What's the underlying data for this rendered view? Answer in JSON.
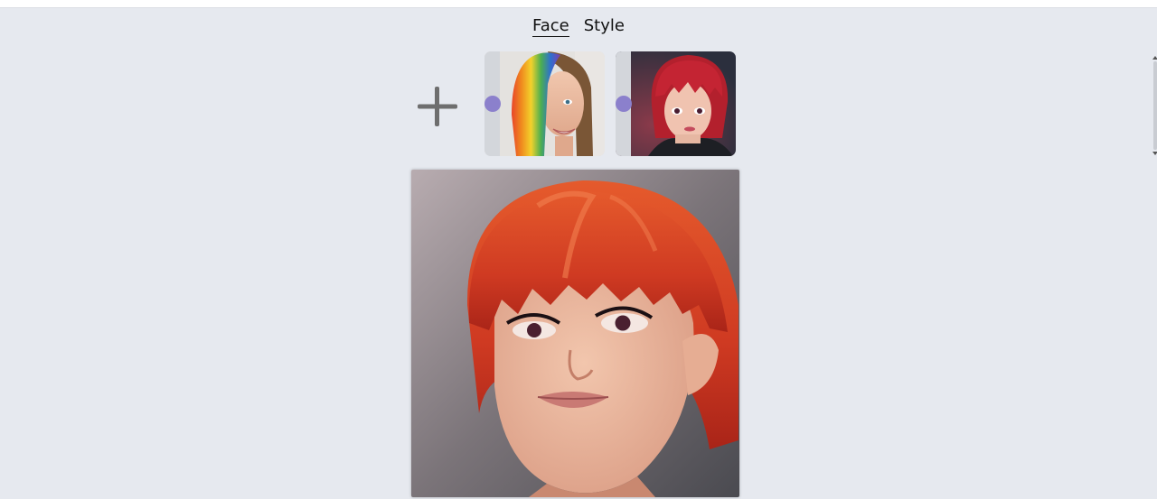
{
  "tabs": [
    {
      "label": "Face",
      "active": true
    },
    {
      "label": "Style",
      "active": false
    }
  ],
  "add_button": {
    "icon": "plus-icon"
  },
  "thumbnails": [
    {
      "name": "rainbow-hair-woman",
      "selected": true
    },
    {
      "name": "red-hair-anime-woman",
      "selected": true
    }
  ],
  "result_image": {
    "name": "generated-red-bob-portrait"
  },
  "colors": {
    "background": "#e6e9ef",
    "accent_dot": "#8b80cc",
    "plus": "#6e6e6e"
  }
}
